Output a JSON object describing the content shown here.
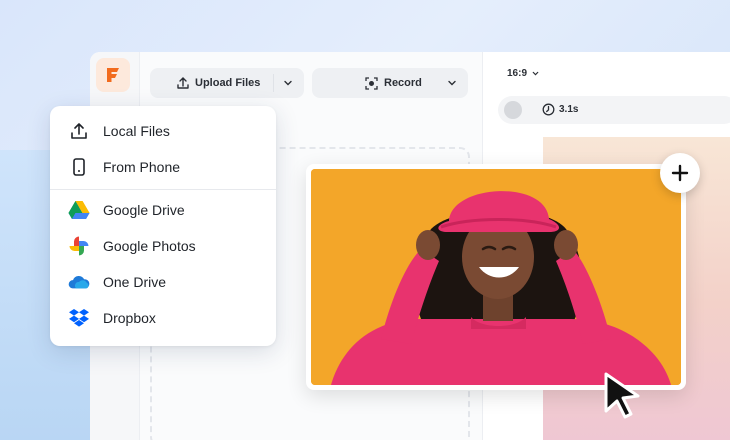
{
  "toolbar": {
    "upload_label": "Upload Files",
    "record_label": "Record",
    "aspect_ratio": "16:9",
    "clip_duration": "3.1s"
  },
  "menu": {
    "items": [
      {
        "label": "Local Files",
        "icon": "upload-icon"
      },
      {
        "label": "From Phone",
        "icon": "phone-icon"
      },
      {
        "label": "Google Drive",
        "icon": "google-drive-icon"
      },
      {
        "label": "Google Photos",
        "icon": "google-photos-icon"
      },
      {
        "label": "One Drive",
        "icon": "onedrive-icon"
      },
      {
        "label": "Dropbox",
        "icon": "dropbox-icon"
      }
    ]
  },
  "colors": {
    "brand": "#f26b1d",
    "photo_bg": "#f3a629",
    "sweater": "#e8336e"
  }
}
